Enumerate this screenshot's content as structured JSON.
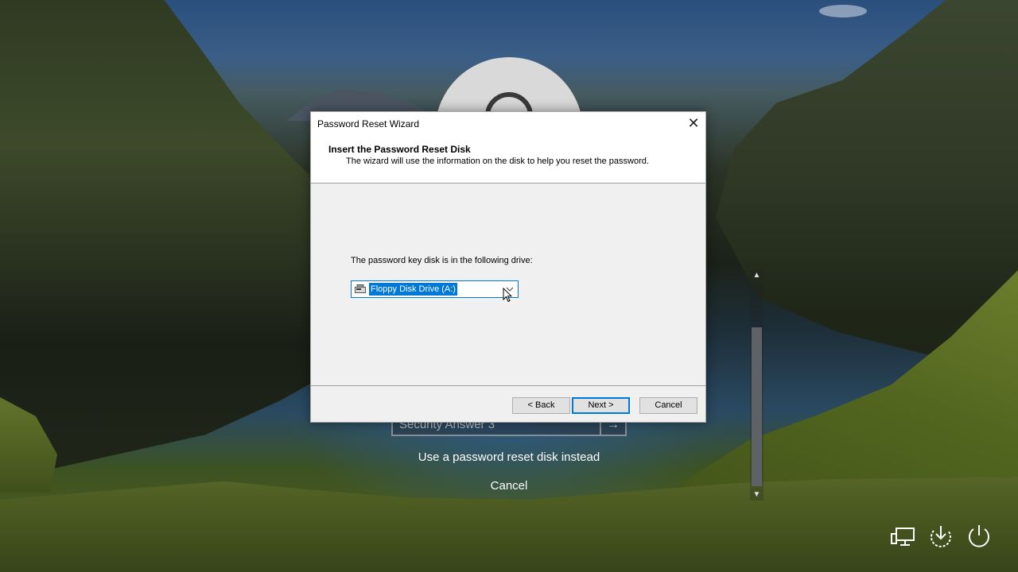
{
  "dialog": {
    "title": "Password Reset Wizard",
    "close_glyph": "✕",
    "header_title": "Insert the Password Reset Disk",
    "header_subtitle": "The wizard will use the information on the disk to help you reset the password.",
    "prompt": "The password key disk is in the following drive:",
    "drive_select": {
      "value": "Floppy Disk Drive (A:)",
      "icon": "floppy-drive-icon"
    },
    "buttons": {
      "back": "< Back",
      "next": "Next >",
      "cancel": "Cancel"
    }
  },
  "login": {
    "security_answer_placeholder": "Security Answer 3",
    "submit_glyph": "→",
    "reset_disk_link": "Use a password reset disk instead",
    "cancel_link": "Cancel"
  },
  "system_icons": [
    "network-icon",
    "ease-of-access-icon",
    "power-icon"
  ],
  "colors": {
    "accent": "#0078d7",
    "dialog_bg": "#f0f0f0"
  }
}
